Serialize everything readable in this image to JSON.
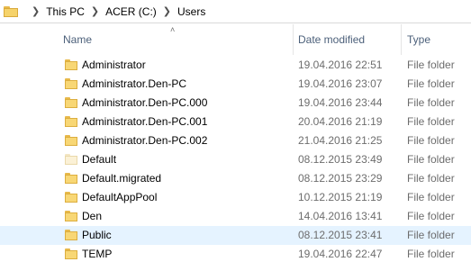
{
  "breadcrumb": {
    "items": [
      "This PC",
      "ACER (C:)",
      "Users"
    ]
  },
  "columns": {
    "name": "Name",
    "date_modified": "Date modified",
    "type": "Type"
  },
  "rows": [
    {
      "name": "Administrator",
      "date": "19.04.2016 22:51",
      "type": "File folder"
    },
    {
      "name": "Administrator.Den-PC",
      "date": "19.04.2016 23:07",
      "type": "File folder"
    },
    {
      "name": "Administrator.Den-PC.000",
      "date": "19.04.2016 23:44",
      "type": "File folder"
    },
    {
      "name": "Administrator.Den-PC.001",
      "date": "20.04.2016 21:19",
      "type": "File folder"
    },
    {
      "name": "Administrator.Den-PC.002",
      "date": "21.04.2016 21:25",
      "type": "File folder"
    },
    {
      "name": "Default",
      "date": "08.12.2015 23:49",
      "type": "File folder"
    },
    {
      "name": "Default.migrated",
      "date": "08.12.2015 23:29",
      "type": "File folder"
    },
    {
      "name": "DefaultAppPool",
      "date": "10.12.2015 21:19",
      "type": "File folder"
    },
    {
      "name": "Den",
      "date": "14.04.2016 13:41",
      "type": "File folder"
    },
    {
      "name": "Public",
      "date": "08.12.2015 23:41",
      "type": "File folder"
    },
    {
      "name": "TEMP",
      "date": "19.04.2016 22:47",
      "type": "File folder"
    }
  ],
  "colors": {
    "folder": "#f8d775",
    "selection": "#e5f3ff",
    "header_text": "#4c607a"
  }
}
